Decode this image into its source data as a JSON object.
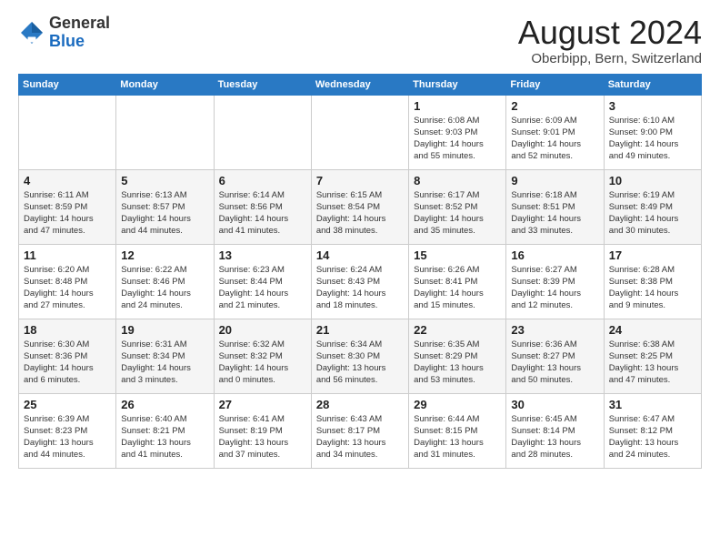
{
  "header": {
    "logo_general": "General",
    "logo_blue": "Blue",
    "month_year": "August 2024",
    "location": "Oberbipp, Bern, Switzerland"
  },
  "days_of_week": [
    "Sunday",
    "Monday",
    "Tuesday",
    "Wednesday",
    "Thursday",
    "Friday",
    "Saturday"
  ],
  "weeks": [
    [
      {
        "day": "",
        "info": ""
      },
      {
        "day": "",
        "info": ""
      },
      {
        "day": "",
        "info": ""
      },
      {
        "day": "",
        "info": ""
      },
      {
        "day": "1",
        "info": "Sunrise: 6:08 AM\nSunset: 9:03 PM\nDaylight: 14 hours\nand 55 minutes."
      },
      {
        "day": "2",
        "info": "Sunrise: 6:09 AM\nSunset: 9:01 PM\nDaylight: 14 hours\nand 52 minutes."
      },
      {
        "day": "3",
        "info": "Sunrise: 6:10 AM\nSunset: 9:00 PM\nDaylight: 14 hours\nand 49 minutes."
      }
    ],
    [
      {
        "day": "4",
        "info": "Sunrise: 6:11 AM\nSunset: 8:59 PM\nDaylight: 14 hours\nand 47 minutes."
      },
      {
        "day": "5",
        "info": "Sunrise: 6:13 AM\nSunset: 8:57 PM\nDaylight: 14 hours\nand 44 minutes."
      },
      {
        "day": "6",
        "info": "Sunrise: 6:14 AM\nSunset: 8:56 PM\nDaylight: 14 hours\nand 41 minutes."
      },
      {
        "day": "7",
        "info": "Sunrise: 6:15 AM\nSunset: 8:54 PM\nDaylight: 14 hours\nand 38 minutes."
      },
      {
        "day": "8",
        "info": "Sunrise: 6:17 AM\nSunset: 8:52 PM\nDaylight: 14 hours\nand 35 minutes."
      },
      {
        "day": "9",
        "info": "Sunrise: 6:18 AM\nSunset: 8:51 PM\nDaylight: 14 hours\nand 33 minutes."
      },
      {
        "day": "10",
        "info": "Sunrise: 6:19 AM\nSunset: 8:49 PM\nDaylight: 14 hours\nand 30 minutes."
      }
    ],
    [
      {
        "day": "11",
        "info": "Sunrise: 6:20 AM\nSunset: 8:48 PM\nDaylight: 14 hours\nand 27 minutes."
      },
      {
        "day": "12",
        "info": "Sunrise: 6:22 AM\nSunset: 8:46 PM\nDaylight: 14 hours\nand 24 minutes."
      },
      {
        "day": "13",
        "info": "Sunrise: 6:23 AM\nSunset: 8:44 PM\nDaylight: 14 hours\nand 21 minutes."
      },
      {
        "day": "14",
        "info": "Sunrise: 6:24 AM\nSunset: 8:43 PM\nDaylight: 14 hours\nand 18 minutes."
      },
      {
        "day": "15",
        "info": "Sunrise: 6:26 AM\nSunset: 8:41 PM\nDaylight: 14 hours\nand 15 minutes."
      },
      {
        "day": "16",
        "info": "Sunrise: 6:27 AM\nSunset: 8:39 PM\nDaylight: 14 hours\nand 12 minutes."
      },
      {
        "day": "17",
        "info": "Sunrise: 6:28 AM\nSunset: 8:38 PM\nDaylight: 14 hours\nand 9 minutes."
      }
    ],
    [
      {
        "day": "18",
        "info": "Sunrise: 6:30 AM\nSunset: 8:36 PM\nDaylight: 14 hours\nand 6 minutes."
      },
      {
        "day": "19",
        "info": "Sunrise: 6:31 AM\nSunset: 8:34 PM\nDaylight: 14 hours\nand 3 minutes."
      },
      {
        "day": "20",
        "info": "Sunrise: 6:32 AM\nSunset: 8:32 PM\nDaylight: 14 hours\nand 0 minutes."
      },
      {
        "day": "21",
        "info": "Sunrise: 6:34 AM\nSunset: 8:30 PM\nDaylight: 13 hours\nand 56 minutes."
      },
      {
        "day": "22",
        "info": "Sunrise: 6:35 AM\nSunset: 8:29 PM\nDaylight: 13 hours\nand 53 minutes."
      },
      {
        "day": "23",
        "info": "Sunrise: 6:36 AM\nSunset: 8:27 PM\nDaylight: 13 hours\nand 50 minutes."
      },
      {
        "day": "24",
        "info": "Sunrise: 6:38 AM\nSunset: 8:25 PM\nDaylight: 13 hours\nand 47 minutes."
      }
    ],
    [
      {
        "day": "25",
        "info": "Sunrise: 6:39 AM\nSunset: 8:23 PM\nDaylight: 13 hours\nand 44 minutes."
      },
      {
        "day": "26",
        "info": "Sunrise: 6:40 AM\nSunset: 8:21 PM\nDaylight: 13 hours\nand 41 minutes."
      },
      {
        "day": "27",
        "info": "Sunrise: 6:41 AM\nSunset: 8:19 PM\nDaylight: 13 hours\nand 37 minutes."
      },
      {
        "day": "28",
        "info": "Sunrise: 6:43 AM\nSunset: 8:17 PM\nDaylight: 13 hours\nand 34 minutes."
      },
      {
        "day": "29",
        "info": "Sunrise: 6:44 AM\nSunset: 8:15 PM\nDaylight: 13 hours\nand 31 minutes."
      },
      {
        "day": "30",
        "info": "Sunrise: 6:45 AM\nSunset: 8:14 PM\nDaylight: 13 hours\nand 28 minutes."
      },
      {
        "day": "31",
        "info": "Sunrise: 6:47 AM\nSunset: 8:12 PM\nDaylight: 13 hours\nand 24 minutes."
      }
    ]
  ]
}
